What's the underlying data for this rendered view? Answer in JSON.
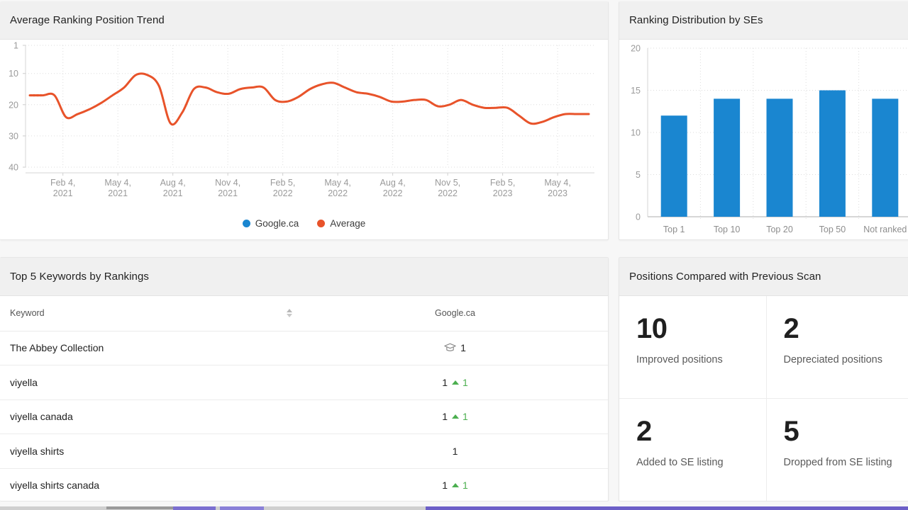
{
  "colors": {
    "accent_orange": "#e8532a",
    "accent_blue": "#1a86d0",
    "positive_green": "#4caf50",
    "panel_header_bg": "#f0f0f0",
    "page_bg": "#f7f7f7"
  },
  "panels": {
    "trend": {
      "title": "Average Ranking Position Trend"
    },
    "distribution": {
      "title": "Ranking Distribution by SEs"
    },
    "keywords": {
      "title": "Top 5 Keywords by Rankings"
    },
    "positions": {
      "title": "Positions Compared with Previous Scan"
    }
  },
  "keywords_table": {
    "columns": [
      {
        "label": "Keyword",
        "sortable": true
      },
      {
        "label": "Google.ca",
        "sortable": true
      }
    ],
    "rows": [
      {
        "keyword": "The Abbey Collection",
        "rank": "1",
        "icon": "graduation-cap-icon",
        "delta": null
      },
      {
        "keyword": "viyella",
        "rank": "1",
        "icon": null,
        "delta": "1"
      },
      {
        "keyword": "viyella canada",
        "rank": "1",
        "icon": null,
        "delta": "1"
      },
      {
        "keyword": "viyella shirts",
        "rank": "1",
        "icon": null,
        "delta": null
      },
      {
        "keyword": "viyella shirts canada",
        "rank": "1",
        "icon": null,
        "delta": "1"
      }
    ]
  },
  "positions_stats": [
    {
      "value": "10",
      "label": "Improved positions"
    },
    {
      "value": "2",
      "label": "Depreciated positions"
    },
    {
      "value": "2",
      "label": "Added to SE listing"
    },
    {
      "value": "5",
      "label": "Dropped from SE listing"
    }
  ],
  "chart_data": [
    {
      "type": "line",
      "title": "Average Ranking Position Trend",
      "xlabel": "",
      "ylabel": "",
      "ylim": [
        1,
        40
      ],
      "y_inverted": true,
      "yticks": [
        1,
        10,
        20,
        30,
        40
      ],
      "grid": true,
      "legend_position": "bottom",
      "categories": [
        "Feb 4,\n2021",
        "May 4,\n2021",
        "Aug 4,\n2021",
        "Nov 4,\n2021",
        "Feb 5,\n2022",
        "May 4,\n2022",
        "Aug 4,\n2022",
        "Nov 5,\n2022",
        "Feb 5,\n2023",
        "May 4,\n2023"
      ],
      "legend": [
        {
          "name": "Google.ca",
          "color": "#1a86d0"
        },
        {
          "name": "Average",
          "color": "#e8532a"
        }
      ],
      "series": [
        {
          "name": "Average",
          "color": "#e8532a",
          "values": [
            17,
            17,
            17,
            24,
            23,
            21.5,
            19.5,
            17,
            14.5,
            10.5,
            10.5,
            14,
            26,
            22.5,
            15,
            14.5,
            16,
            16.5,
            15,
            14.5,
            14.5,
            18.5,
            19,
            17.5,
            15,
            13.5,
            13,
            14.5,
            16,
            16.5,
            17.5,
            19,
            19,
            18.5,
            18.5,
            20.5,
            20,
            18.5,
            20,
            21,
            21,
            21,
            23.5,
            26,
            25.5,
            24,
            23,
            23,
            23
          ]
        }
      ]
    },
    {
      "type": "bar",
      "title": "Ranking Distribution by SEs",
      "categories": [
        "Top 1",
        "Top 10",
        "Top 20",
        "Top 50",
        "Not ranked"
      ],
      "values": [
        12,
        14,
        14,
        15,
        14
      ],
      "series": [
        {
          "name": "Google.ca",
          "color": "#1a86d0",
          "values": [
            12,
            14,
            14,
            15,
            14
          ]
        }
      ],
      "xlabel": "",
      "ylabel": "",
      "ylim": [
        0,
        20
      ],
      "yticks": [
        0,
        5,
        10,
        15,
        20
      ],
      "grid": true,
      "legend_position": "none"
    }
  ]
}
